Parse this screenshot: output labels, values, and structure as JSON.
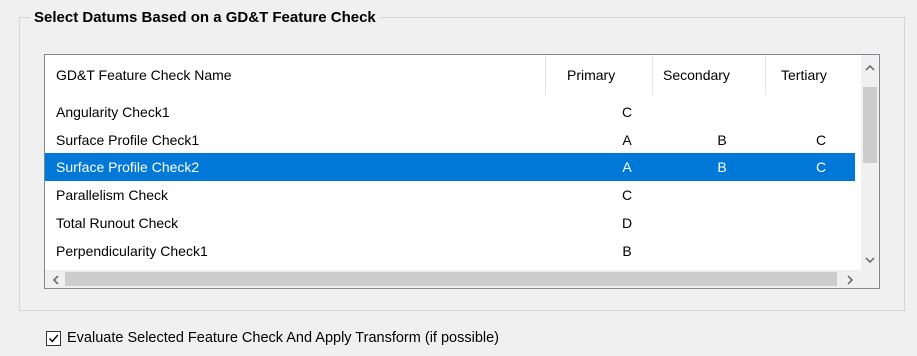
{
  "group": {
    "title": "Select Datums Based on a GD&T Feature Check"
  },
  "table": {
    "headers": {
      "name": "GD&T Feature Check Name",
      "primary": "Primary",
      "secondary": "Secondary",
      "tertiary": "Tertiary"
    },
    "rows": [
      {
        "name": "Angularity Check1",
        "primary": "C",
        "secondary": "",
        "tertiary": ""
      },
      {
        "name": "Surface Profile Check1",
        "primary": "A",
        "secondary": "B",
        "tertiary": "C"
      },
      {
        "name": "Surface Profile Check2",
        "primary": "A",
        "secondary": "B",
        "tertiary": "C",
        "selected": true
      },
      {
        "name": "Parallelism Check",
        "primary": "C",
        "secondary": "",
        "tertiary": ""
      },
      {
        "name": "Total Runout Check",
        "primary": "D",
        "secondary": "",
        "tertiary": ""
      },
      {
        "name": "Perpendicularity Check1",
        "primary": "B",
        "secondary": "",
        "tertiary": ""
      }
    ],
    "selection_color": "#0078d7"
  },
  "checkbox": {
    "label": "Evaluate Selected Feature Check And Apply Transform (if possible)",
    "checked": true
  },
  "icons": {
    "scroll_up": "chevron-up-icon",
    "scroll_down": "chevron-down-icon",
    "scroll_left": "chevron-left-icon",
    "scroll_right": "chevron-right-icon",
    "check": "checkmark-icon"
  }
}
